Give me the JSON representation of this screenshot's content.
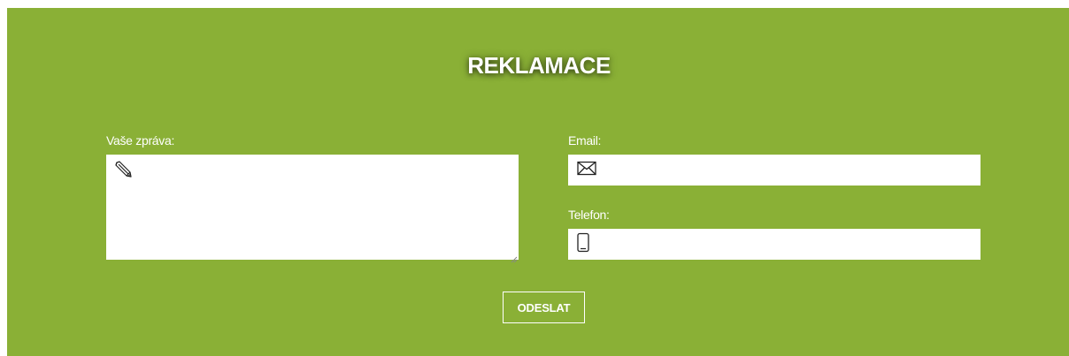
{
  "form": {
    "title": "REKLAMACE",
    "message": {
      "label": "Vaše zpráva:",
      "icon": "pencil-icon",
      "value": ""
    },
    "email": {
      "label": "Email:",
      "icon": "envelope-icon",
      "value": ""
    },
    "phone": {
      "label": "Telefon:",
      "icon": "smartphone-icon",
      "value": ""
    },
    "submit_label": "ODESLAT"
  },
  "colors": {
    "panel_background": "#8ab036",
    "text": "#ffffff",
    "field_background": "#ffffff"
  }
}
